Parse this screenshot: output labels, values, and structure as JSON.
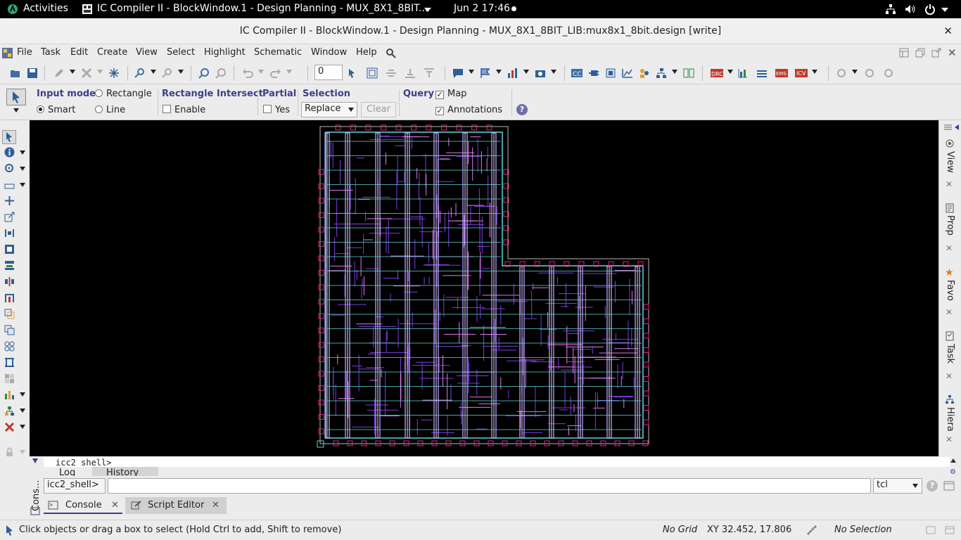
{
  "topbar": {
    "activities": "Activities",
    "app_title": "IC Compiler II - BlockWindow.1 - Design Planning - MUX_8X1_8BIT...",
    "clock": "Jun 2  17:46"
  },
  "window": {
    "title": "IC Compiler II - BlockWindow.1 - Design Planning - MUX_8X1_8BIT_LIB:mux8x1_8bit.design [write]"
  },
  "menu": [
    "File",
    "Task",
    "Edit",
    "Create",
    "View",
    "Select",
    "Highlight",
    "Schematic",
    "Window",
    "Help"
  ],
  "toolbar": {
    "layer_value": "0"
  },
  "options": {
    "input_mode_label": "Input mode",
    "rectangle": "Rectangle",
    "smart": "Smart",
    "line": "Line",
    "rect_intersect_label": "Rectangle Intersect",
    "enable": "Enable",
    "partial_label": "Partial",
    "yes": "Yes",
    "selection_label": "Selection",
    "selection_value": "Replace",
    "clear": "Clear",
    "query_label": "Query",
    "map": "Map",
    "annotations": "Annotations"
  },
  "right_tabs": [
    "View",
    "Prop",
    "Favo",
    "Task",
    "Hiera"
  ],
  "console": {
    "output_line": "icc2_shell>",
    "tab_log": "Log",
    "tab_history": "History",
    "prompt": "icc2_shell>",
    "command_value": "",
    "language": "tcl",
    "side_label": "Cons...",
    "bottom_tab_console": "Console",
    "bottom_tab_script": "Script Editor"
  },
  "status": {
    "hint": "Click objects or drag a box to select (Hold Ctrl to add, Shift to remove)",
    "grid": "No Grid",
    "xy": "XY 32.452, 17.806",
    "selection": "No Selection"
  },
  "colors": {
    "canvas": "#000000",
    "boundary": "#b7b7b7",
    "pin": "#e0257f",
    "power_rail": "#5fd7d7",
    "power_stripe": "#b9a0ff",
    "signal_route": "#7a3ee0",
    "group_label": "#3f3e8c"
  }
}
